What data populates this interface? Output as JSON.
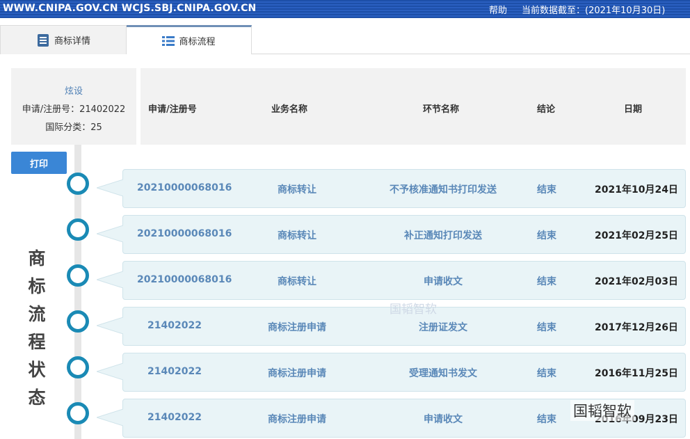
{
  "topbar": {
    "site": "WWW.CNIPA.GOV.CN WCJS.SBJ.CNIPA.GOV.CN",
    "help": "帮助",
    "date": "当前数据截至：(2021年10月30日)"
  },
  "tabs": {
    "details": "商标详情",
    "flow": "商标流程"
  },
  "info": {
    "name": "炫设",
    "reg_line": "申请/注册号：21402022",
    "class_line": "国际分类：25"
  },
  "columns": {
    "reg": "申请/注册号",
    "business": "业务名称",
    "stage": "环节名称",
    "result": "结论",
    "date": "日期"
  },
  "print_label": "打印",
  "vertical_title": "商标流程状态",
  "rows": [
    {
      "reg": "20210000068016",
      "business": "商标转让",
      "stage": "不予核准通知书打印发送",
      "result": "结束",
      "date": "2021年10月24日"
    },
    {
      "reg": "20210000068016",
      "business": "商标转让",
      "stage": "补正通知打印发送",
      "result": "结束",
      "date": "2021年02月25日"
    },
    {
      "reg": "20210000068016",
      "business": "商标转让",
      "stage": "申请收文",
      "result": "结束",
      "date": "2021年02月03日"
    },
    {
      "reg": "21402022",
      "business": "商标注册申请",
      "stage": "注册证发文",
      "result": "结束",
      "date": "2017年12月26日"
    },
    {
      "reg": "21402022",
      "business": "商标注册申请",
      "stage": "受理通知书发文",
      "result": "结束",
      "date": "2016年11月25日"
    },
    {
      "reg": "21402022",
      "business": "商标注册申请",
      "stage": "申请收文",
      "result": "结束",
      "date": "2016年09月23日"
    }
  ],
  "watermark": {
    "center": "国韬智软",
    "corner": "国韬智软"
  },
  "colors": {
    "accent": "#1a8ab5",
    "link": "#5a88b8",
    "button": "#3a86d6",
    "row_bg": "#e9f4f7"
  }
}
